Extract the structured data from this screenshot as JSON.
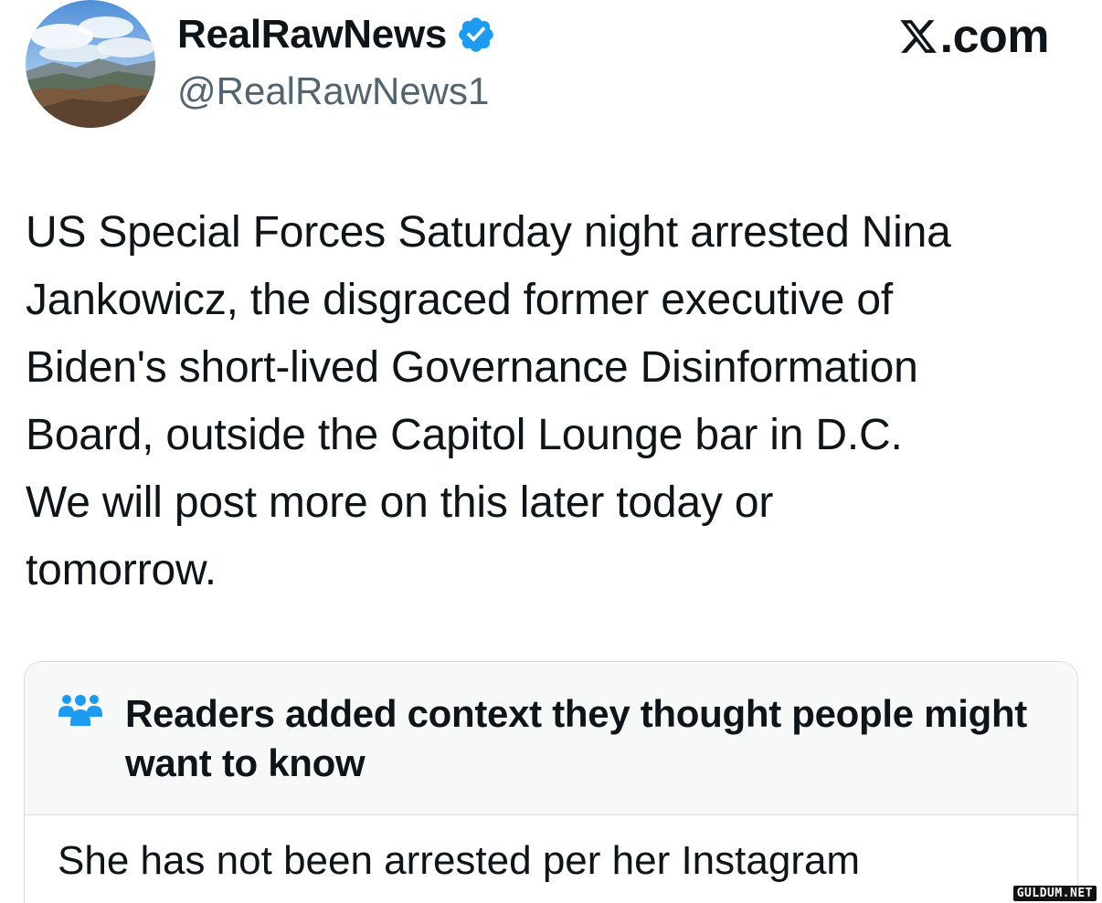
{
  "author": {
    "display_name": "RealRawNews",
    "handle": "@RealRawNews1",
    "verified": true,
    "avatar_icon": "landscape-avatar"
  },
  "brand": {
    "logo_icon": "x-logo-icon",
    "text": ".com"
  },
  "tweet": {
    "text": "US Special Forces Saturday night arrested Nina\nJankowicz, the disgraced former executive of\nBiden's short-lived Governance Disinformation\nBoard, outside the Capitol Lounge bar in D.C.\nWe will post more on this later today or\ntomorrow."
  },
  "community_note": {
    "icon": "people-icon",
    "title": "Readers added context they thought people might want to know",
    "body": "She has not been arrested per her Instagram"
  },
  "watermark": {
    "text": "GULDUM.NET"
  },
  "colors": {
    "verified_blue": "#1d9bf0",
    "text_primary": "#0f1419",
    "text_secondary": "#536471",
    "note_header_bg": "#f7f9f9",
    "border": "#d6dde2"
  }
}
